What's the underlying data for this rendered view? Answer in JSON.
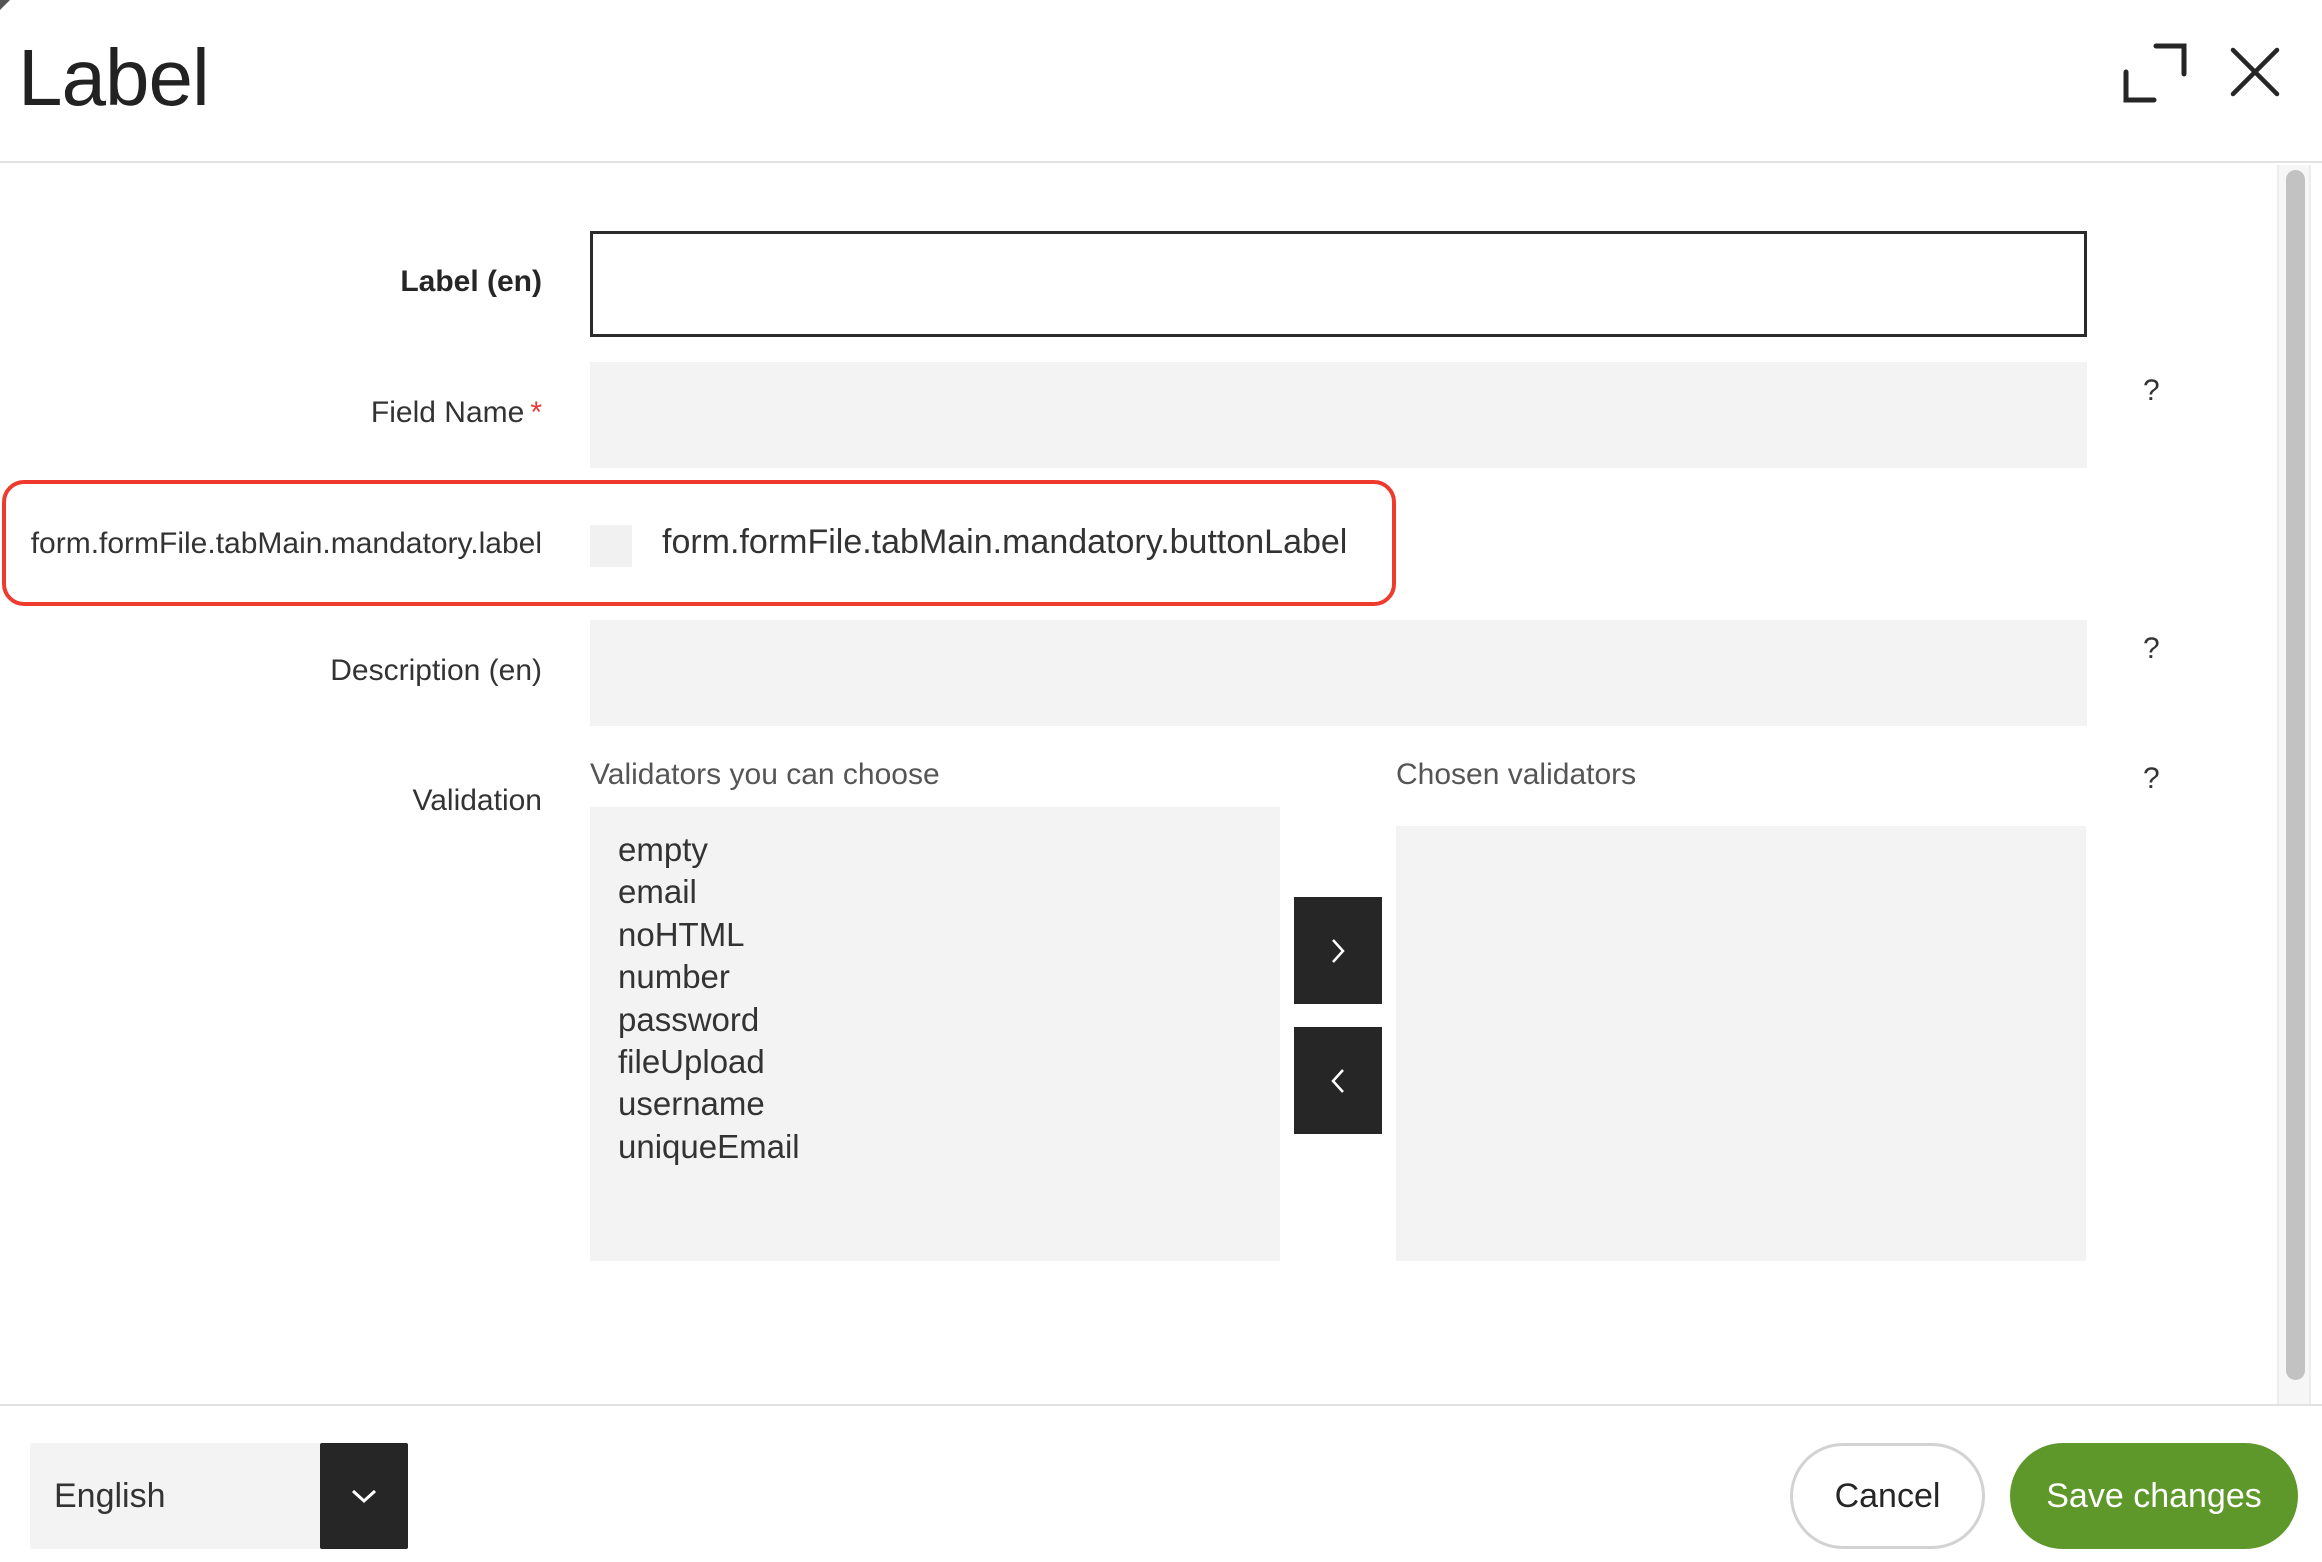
{
  "dialog": {
    "title": "Label",
    "icons": {
      "expand": "expand-icon",
      "close": "close-icon"
    }
  },
  "form": {
    "label_field": {
      "label": "Label (en)",
      "value": "",
      "placeholder": ""
    },
    "field_name": {
      "label": "Field Name",
      "required_marker": "*",
      "value": "",
      "help": "?"
    },
    "mandatory": {
      "label": "form.formFile.tabMain.mandatory.label",
      "checkbox_label": "form.formFile.tabMain.mandatory.buttonLabel",
      "checked": false
    },
    "description": {
      "label": "Description (en)",
      "value": "",
      "help": "?"
    },
    "validation": {
      "label": "Validation",
      "available_header": "Validators you can choose",
      "chosen_header": "Chosen validators",
      "help": "?",
      "available": [
        "empty",
        "email",
        "noHTML",
        "number",
        "password",
        "fileUpload",
        "username",
        "uniqueEmail"
      ],
      "chosen": [],
      "add_icon": "chevron-right-icon",
      "remove_icon": "chevron-left-icon"
    }
  },
  "highlight": {
    "color": "#ef3b2d"
  },
  "footer": {
    "language": {
      "selected": "English",
      "icon": "chevron-down-icon"
    },
    "cancel_label": "Cancel",
    "save_label": "Save changes",
    "save_color": "#5e982b"
  }
}
